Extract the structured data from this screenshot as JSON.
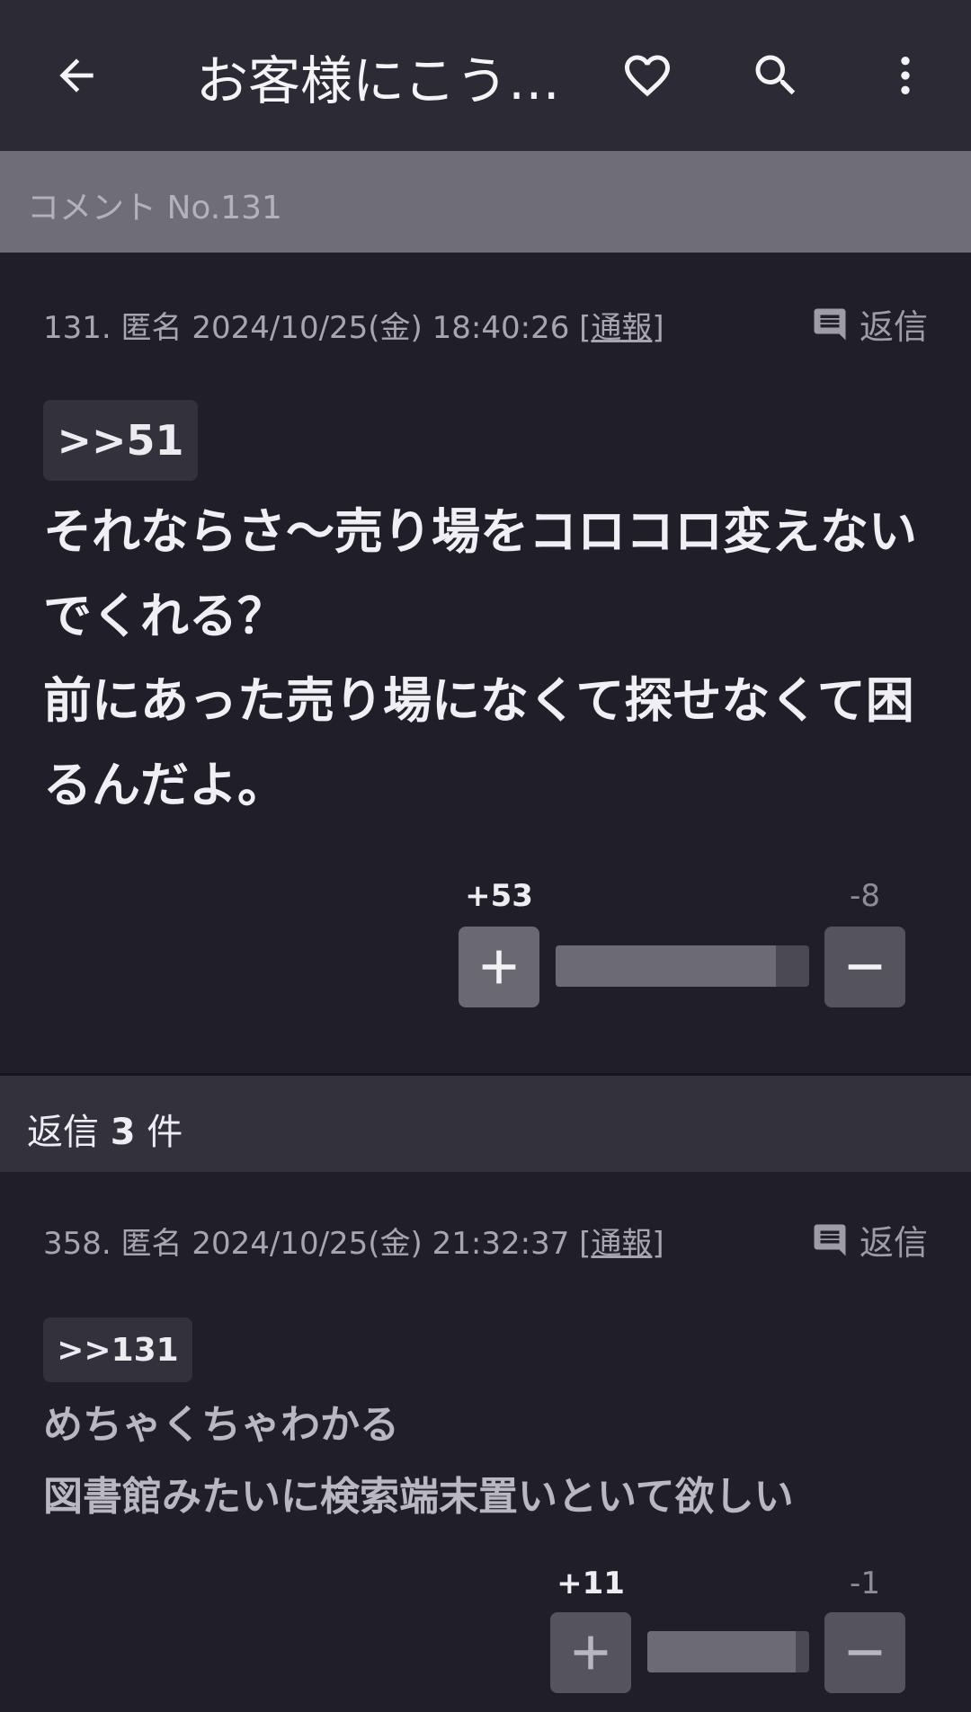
{
  "appbar": {
    "title": "お客様にこう…",
    "icons": [
      "back-arrow-icon",
      "heart-icon",
      "search-icon",
      "more-vert-icon"
    ]
  },
  "section": {
    "label": "コメント No.131"
  },
  "main_comment": {
    "number": "131.",
    "author": "匿名",
    "datetime": "2024/10/25(金) 18:40:26",
    "report_label": "通報",
    "reply_label": "返信",
    "anchor": ">>51",
    "body": "それならさ～売り場をコロコロ変えないでくれる？\n前にあった売り場になくて探せなくて困るんだよ。",
    "plus_count": "+53",
    "minus_count": "-8",
    "plus_fraction": 0.869
  },
  "replies_header": {
    "prefix": "返信",
    "count": "3",
    "suffix": "件"
  },
  "reply_comment": {
    "number": "358.",
    "author": "匿名",
    "datetime": "2024/10/25(金) 21:32:37",
    "report_label": "通報",
    "reply_label": "返信",
    "anchor": ">>131",
    "body": "めちゃくちゃわかる\n図書館みたいに検索端末置いといて欲しい",
    "plus_count": "+11",
    "minus_count": "-1",
    "plus_fraction": 0.917
  },
  "colors": {
    "background": "#201f29",
    "appbar": "#2c2b35",
    "section_bar": "#6f6e78",
    "plus_count": "#ededf2",
    "minus_count": "#8e8d96"
  }
}
